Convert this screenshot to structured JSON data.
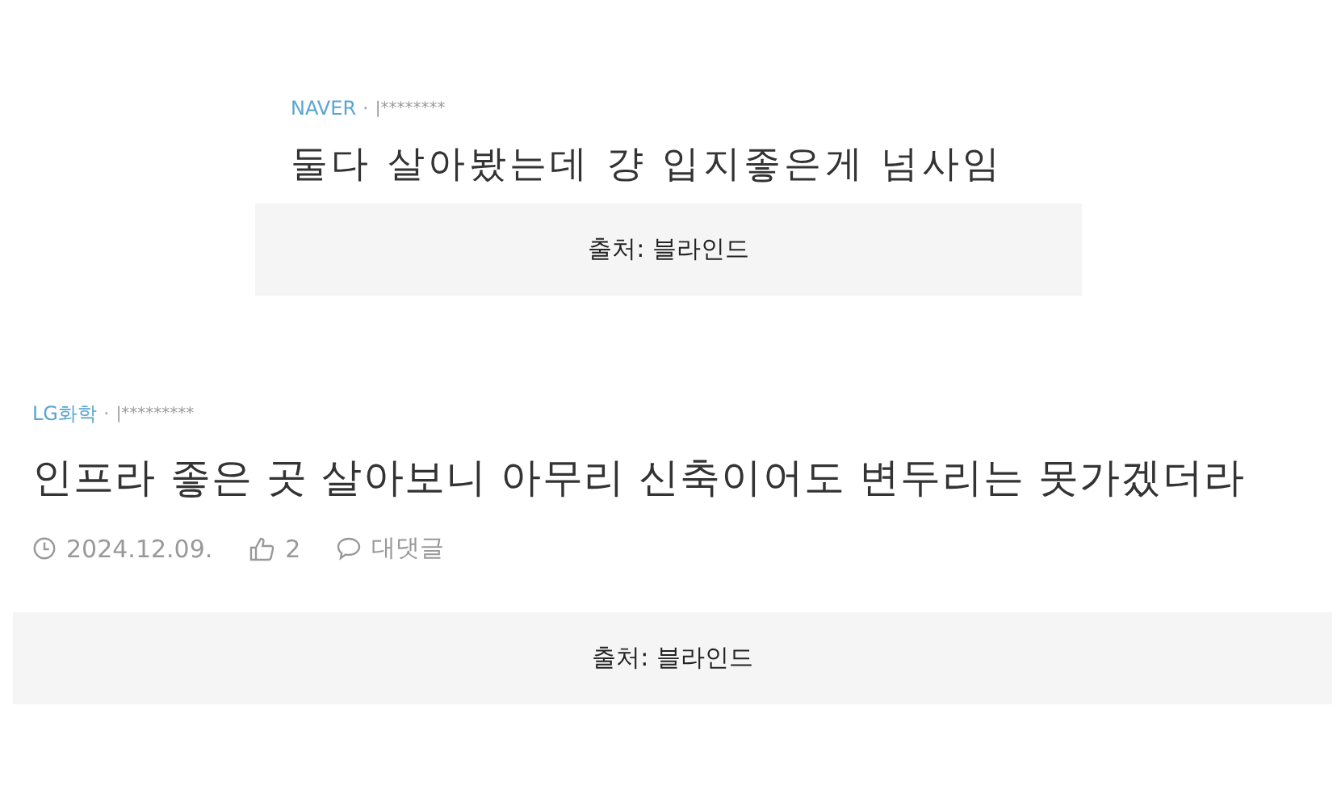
{
  "sections": [
    {
      "post": {
        "company": "NAVER",
        "separator": "·",
        "user": "|********",
        "text": "둘다 살아봤는데 걍 입지좋은게 넘사임"
      },
      "caption": "출처: 블라인드"
    },
    {
      "post": {
        "company": "LG화학",
        "separator": "·",
        "user": "|*********",
        "text": "인프라 좋은 곳 살아보니 아무리 신축이어도 변두리는 못가겠더라",
        "footer": {
          "date": "2024.12.09.",
          "likes": "2",
          "comments": "대댓글"
        }
      },
      "caption": "출처: 블라인드"
    }
  ]
}
